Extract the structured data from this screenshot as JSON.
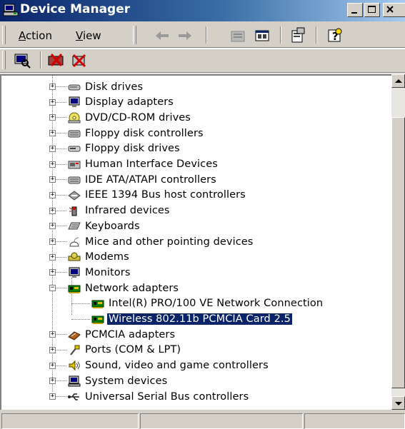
{
  "window": {
    "title": "Device Manager"
  },
  "menu": {
    "action": "Action",
    "view": "View"
  },
  "toolbar": [
    "back-icon",
    "forward-icon",
    "up-folder-icon",
    "properties-view-icon",
    "properties-icon",
    "help-icon"
  ],
  "toolbar2": [
    "scan-hardware-icon",
    "uninstall-icon",
    "disable-icon"
  ],
  "tree": {
    "items": [
      {
        "label": "Disk drives",
        "icon": "disk-drive-icon",
        "level": 1,
        "state": "collapsed"
      },
      {
        "label": "Display adapters",
        "icon": "monitor-icon",
        "level": 1,
        "state": "collapsed"
      },
      {
        "label": "DVD/CD-ROM drives",
        "icon": "cdrom-icon",
        "level": 1,
        "state": "collapsed"
      },
      {
        "label": "Floppy disk controllers",
        "icon": "controller-icon",
        "level": 1,
        "state": "collapsed"
      },
      {
        "label": "Floppy disk drives",
        "icon": "floppy-icon",
        "level": 1,
        "state": "collapsed"
      },
      {
        "label": "Human Interface Devices",
        "icon": "hid-icon",
        "level": 1,
        "state": "collapsed"
      },
      {
        "label": "IDE ATA/ATAPI controllers",
        "icon": "controller-icon",
        "level": 1,
        "state": "collapsed"
      },
      {
        "label": "IEEE 1394 Bus host controllers",
        "icon": "firewire-icon",
        "level": 1,
        "state": "collapsed"
      },
      {
        "label": "Infrared devices",
        "icon": "infrared-icon",
        "level": 1,
        "state": "collapsed"
      },
      {
        "label": "Keyboards",
        "icon": "keyboard-icon",
        "level": 1,
        "state": "collapsed"
      },
      {
        "label": "Mice and other pointing devices",
        "icon": "mouse-icon",
        "level": 1,
        "state": "collapsed"
      },
      {
        "label": "Modems",
        "icon": "modem-icon",
        "level": 1,
        "state": "collapsed"
      },
      {
        "label": "Monitors",
        "icon": "monitor-icon",
        "level": 1,
        "state": "collapsed"
      },
      {
        "label": "Network adapters",
        "icon": "network-card-icon",
        "level": 1,
        "state": "expanded"
      },
      {
        "label": "Intel(R) PRO/100 VE Network Connection",
        "icon": "network-card-icon",
        "level": 2,
        "state": "leaf"
      },
      {
        "label": "Wireless 802.11b PCMCIA Card 2.5",
        "icon": "network-card-icon",
        "level": 2,
        "state": "leaf",
        "selected": true
      },
      {
        "label": "PCMCIA adapters",
        "icon": "pcmcia-icon",
        "level": 1,
        "state": "collapsed"
      },
      {
        "label": "Ports (COM & LPT)",
        "icon": "port-icon",
        "level": 1,
        "state": "collapsed"
      },
      {
        "label": "Sound, video and game controllers",
        "icon": "sound-icon",
        "level": 1,
        "state": "collapsed"
      },
      {
        "label": "System devices",
        "icon": "computer-icon",
        "level": 1,
        "state": "collapsed"
      },
      {
        "label": "Universal Serial Bus controllers",
        "icon": "usb-icon",
        "level": 1,
        "state": "collapsed"
      }
    ]
  },
  "colors": {
    "titlebar": "#0a246a",
    "selection": "#0a246a",
    "face": "#d4d0c8"
  }
}
